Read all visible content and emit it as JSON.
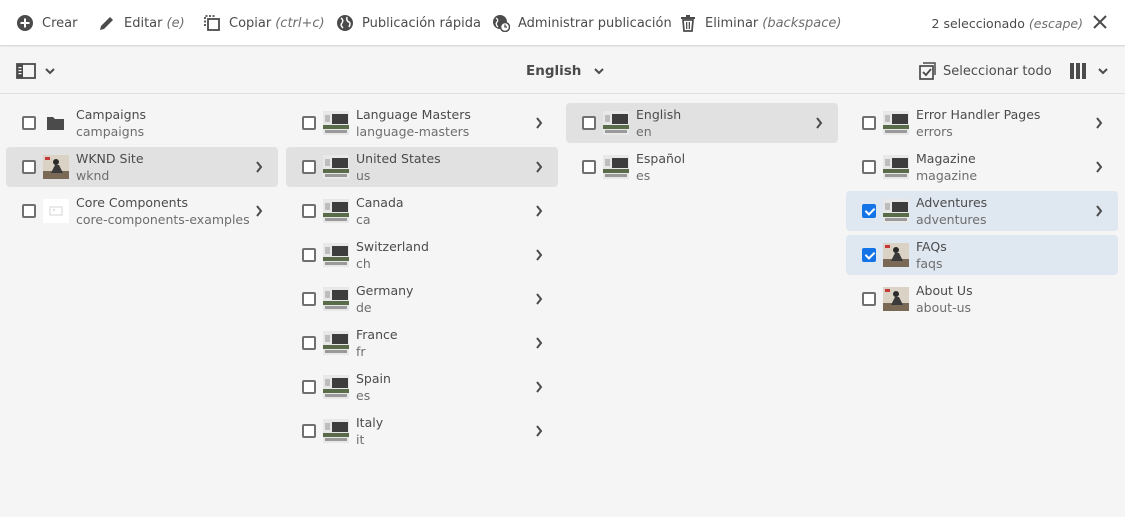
{
  "actionbar": {
    "create": "Crear",
    "edit": "Editar",
    "edit_hint": "(e)",
    "copy": "Copiar",
    "copy_hint": "(ctrl+c)",
    "quick_publish": "Publicación rápida",
    "manage_publication": "Administrar publicación",
    "delete": "Eliminar",
    "delete_hint": "(backspace)",
    "selection": "2 seleccionado",
    "selection_hint": "(escape)"
  },
  "toolbar": {
    "language": "English",
    "select_all": "Seleccionar todo"
  },
  "columns": [
    {
      "items": [
        {
          "title": "Campaigns",
          "name": "campaigns"
        },
        {
          "title": "WKND Site",
          "name": "wknd"
        },
        {
          "title": "Core Components",
          "name": "core-components-examples"
        }
      ]
    },
    {
      "items": [
        {
          "title": "Language Masters",
          "name": "language-masters"
        },
        {
          "title": "United States",
          "name": "us"
        },
        {
          "title": "Canada",
          "name": "ca"
        },
        {
          "title": "Switzerland",
          "name": "ch"
        },
        {
          "title": "Germany",
          "name": "de"
        },
        {
          "title": "France",
          "name": "fr"
        },
        {
          "title": "Spain",
          "name": "es"
        },
        {
          "title": "Italy",
          "name": "it"
        }
      ]
    },
    {
      "items": [
        {
          "title": "English",
          "name": "en"
        },
        {
          "title": "Español",
          "name": "es"
        }
      ]
    },
    {
      "items": [
        {
          "title": "Error Handler Pages",
          "name": "errors"
        },
        {
          "title": "Magazine",
          "name": "magazine"
        },
        {
          "title": "Adventures",
          "name": "adventures",
          "checked": true
        },
        {
          "title": "FAQs",
          "name": "faqs",
          "checked": true
        },
        {
          "title": "About Us",
          "name": "about-us"
        }
      ]
    }
  ],
  "colors": {
    "accent": "#1473e6",
    "selected_row": "#dfe7f0",
    "active_row": "#e1e1e1"
  }
}
